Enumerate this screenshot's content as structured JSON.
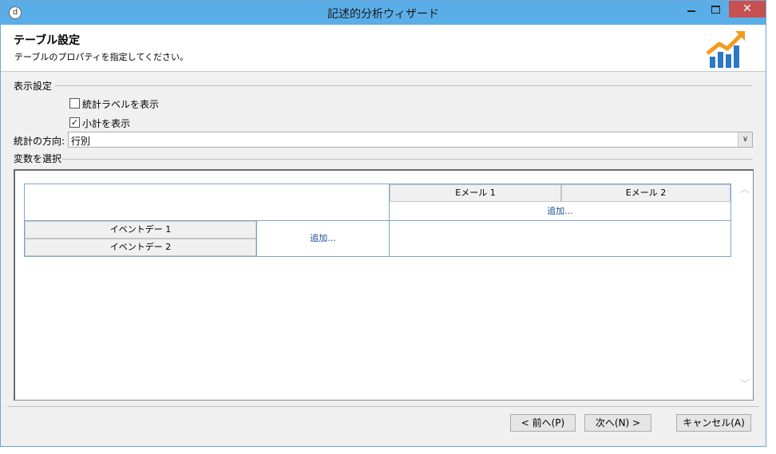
{
  "window": {
    "title": "記述的分析ウィザード"
  },
  "titlebar_controls": {
    "minimize": "minimize-icon",
    "maximize": "maximize-icon",
    "close": "✕"
  },
  "header": {
    "title": "テーブル設定",
    "subtitle": "テーブルのプロパティを指定してください。",
    "logo": "chart-logo-icon"
  },
  "display_settings": {
    "group_label": "表示設定",
    "show_stat_labels": {
      "label": "統計ラベルを表示",
      "checked": false
    },
    "show_subtotals": {
      "label": "小計を表示",
      "checked": true,
      "mark": "✓"
    }
  },
  "stat_direction": {
    "label": "統計の方向:",
    "value": "行別",
    "dropdown_arrow": "∨"
  },
  "variables": {
    "group_label": "変数を選択",
    "columns": [
      "Eメール 1",
      "Eメール 2"
    ],
    "rows": [
      "イベントデー 1",
      "イベントデー 2"
    ],
    "add_column_link": "追加...",
    "add_row_link": "追加..."
  },
  "scrollbar": {
    "up": "︿",
    "down": "﹀"
  },
  "footer": {
    "back": "< 前へ(P)",
    "next": "次へ(N) >",
    "cancel": "キャンセル(A)"
  }
}
